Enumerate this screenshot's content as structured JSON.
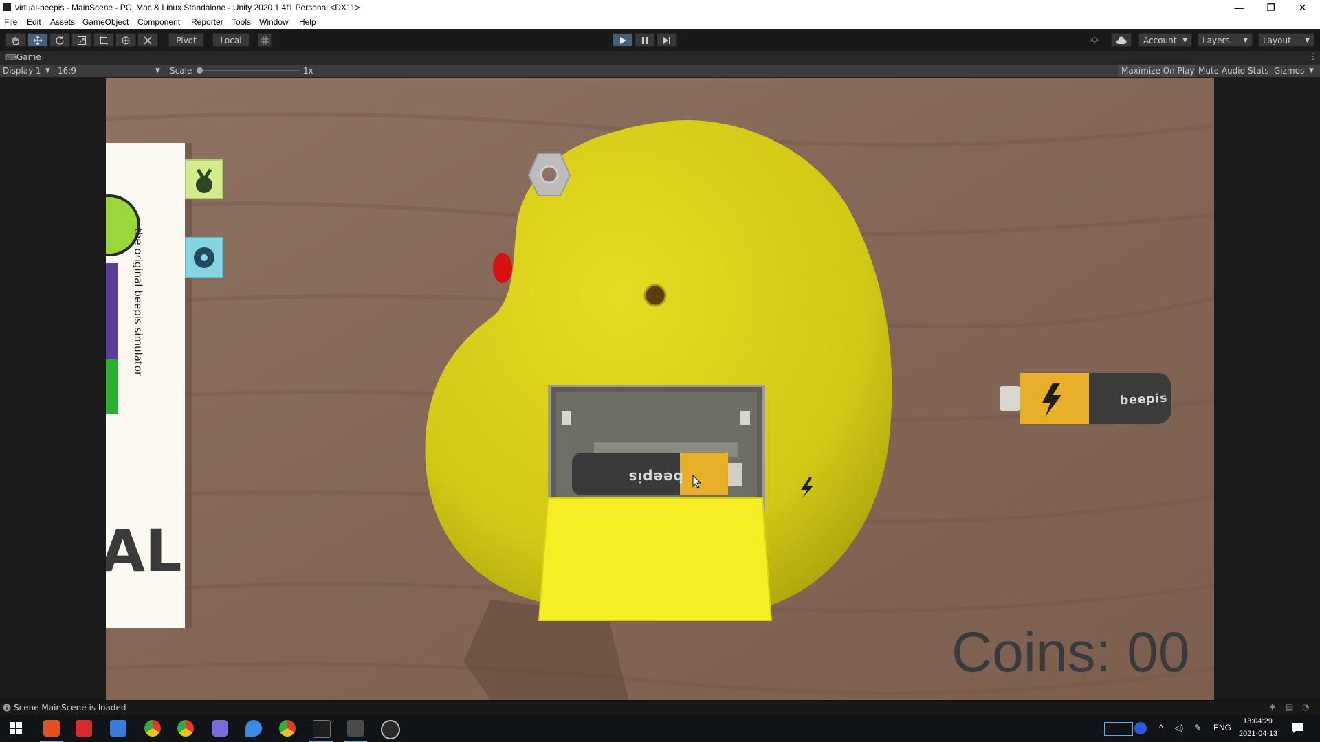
{
  "window": {
    "title": "virtual-beepis - MainScene - PC, Mac & Linux Standalone - Unity 2020.1.4f1 Personal <DX11>",
    "controls": [
      "—",
      "❐",
      "✕"
    ]
  },
  "menu": [
    "File",
    "Edit",
    "Assets",
    "GameObject",
    "Component",
    "Reporter",
    "Tools",
    "Window",
    "Help"
  ],
  "toolbar": {
    "pivot_label": "Pivot",
    "local_label": "Local",
    "account_label": "Account",
    "layers_label": "Layers",
    "layout_label": "Layout"
  },
  "game_view": {
    "tab_label": "Game",
    "display_label": "Display 1",
    "aspect_label": "16:9",
    "scale_label": "Scale",
    "scale_value": "1x",
    "maximize_label": "Maximize On Play",
    "mute_label": "Mute Audio",
    "stats_label": "Stats",
    "gizmos_label": "Gizmos"
  },
  "scene": {
    "coins_text": "Coins: 00",
    "battery_brand": "beepis",
    "inserted_battery_brand": "beepis",
    "card_tagline": "the original beepis simulator",
    "card_big_letters": "AL",
    "colors": {
      "table": "#8b6d5c",
      "beepis_body": "#d8d018",
      "battery_gold": "#e8b028",
      "battery_dark": "#3a3a3a"
    }
  },
  "status": {
    "message": "Scene MainScene is loaded"
  },
  "taskbar": {
    "language": "ENG",
    "time": "13:04:29",
    "date": "2021-04-13"
  }
}
